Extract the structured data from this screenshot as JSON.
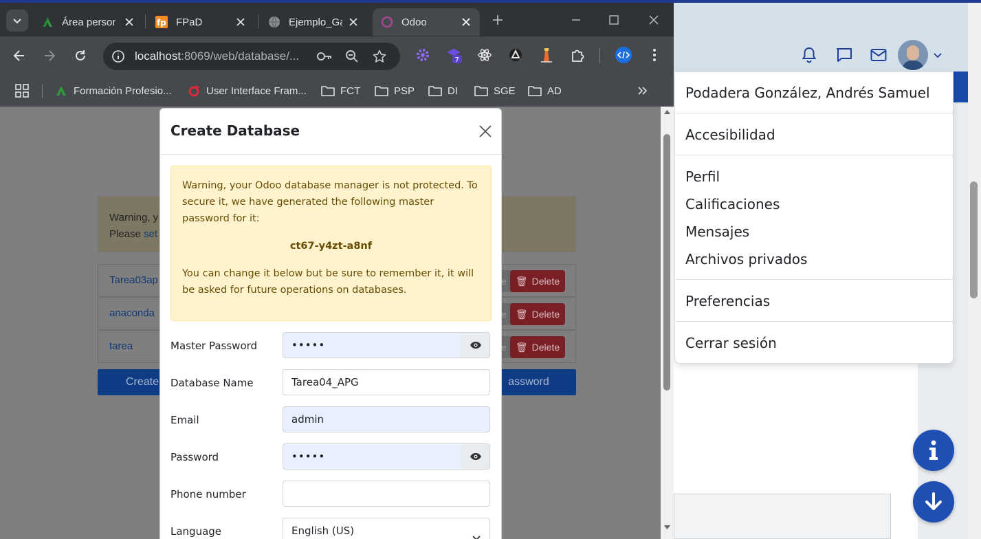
{
  "browser": {
    "tabs": [
      {
        "label": "Área personal",
        "favicon": "green-a-icon"
      },
      {
        "label": "FPaD",
        "favicon": "fpad-icon"
      },
      {
        "label": "Ejemplo_Ga",
        "favicon": "globe-icon"
      },
      {
        "label": "Odoo",
        "favicon": "odoo-icon",
        "active": true
      }
    ],
    "url_host": "localhost",
    "url_path": ":8069/web/database/...",
    "extension_badge": "7",
    "bookmarks": [
      {
        "label": "Formación Profesio...",
        "icon": "green-a-icon"
      },
      {
        "label": "User Interface Fram...",
        "icon": "red-swirl-icon"
      },
      {
        "label": "FCT",
        "icon": "folder-icon"
      },
      {
        "label": "PSP",
        "icon": "folder-icon"
      },
      {
        "label": "DI",
        "icon": "folder-icon"
      },
      {
        "label": "SGE",
        "icon": "folder-icon"
      },
      {
        "label": "AD",
        "icon": "folder-icon"
      }
    ]
  },
  "db_manager": {
    "warning_line1": "Warning, y",
    "warning_line2_prefix": "Please ",
    "warning_line2_link": "set",
    "databases": [
      "Tarea03ap",
      "anaconda",
      "tarea"
    ],
    "delete_label": "Delete",
    "create_label": "Create",
    "password_label": "assword"
  },
  "modal": {
    "title": "Create Database",
    "alert_text": "Warning, your Odoo database manager is not protected. To secure it, we have generated the following master password for it:",
    "generated_password": "ct67-y4zt-a8nf",
    "alert_text_2": "You can change it below but be sure to remember it, it will be asked for future operations on databases.",
    "fields": {
      "master_password": {
        "label": "Master Password",
        "value": "•••••"
      },
      "database_name": {
        "label": "Database Name",
        "value": "Tarea04_APG"
      },
      "email": {
        "label": "Email",
        "value": "admin"
      },
      "password": {
        "label": "Password",
        "value": "•••••"
      },
      "phone": {
        "label": "Phone number",
        "value": ""
      },
      "language": {
        "label": "Language",
        "value": "English (US)"
      }
    }
  },
  "user_menu": {
    "user_name": "Podadera González, Andrés Samuel",
    "accessibility": "Accesibilidad",
    "profile": "Perfil",
    "grades": "Calificaciones",
    "messages": "Mensajes",
    "private_files": "Archivos privados",
    "preferences": "Preferencias",
    "logout": "Cerrar sesión"
  },
  "colors": {
    "accent_blue": "#1f4fb3",
    "alert_bg": "#fff3cd",
    "alert_text": "#664d03",
    "delete_red": "#7b1f27"
  }
}
